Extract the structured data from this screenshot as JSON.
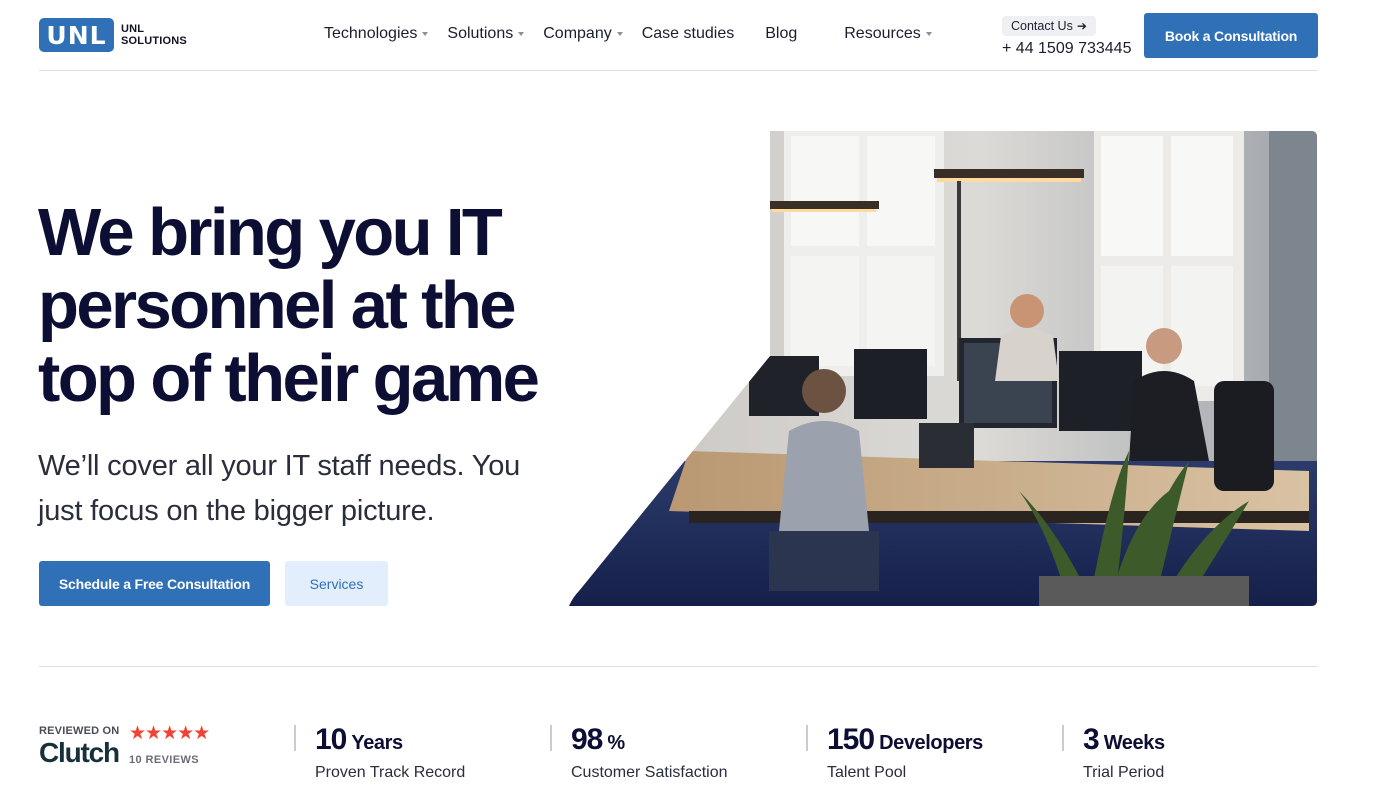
{
  "header": {
    "logo_mark": "UNL",
    "logo_line1": "UNL",
    "logo_line2": "SOLUTIONS",
    "nav": [
      {
        "label": "Technologies",
        "has_dropdown": true
      },
      {
        "label": "Solutions",
        "has_dropdown": true
      },
      {
        "label": "Company",
        "has_dropdown": true
      },
      {
        "label": "Case studies",
        "has_dropdown": false
      },
      {
        "label": "Blog",
        "has_dropdown": false
      },
      {
        "label": "Resources",
        "has_dropdown": true
      }
    ],
    "contact_label": "Contact Us",
    "contact_icon": "arrow-right-icon",
    "phone": "+ 44 1509 733445",
    "cta": "Book a Consultation"
  },
  "hero": {
    "title_lines": [
      "We bring you IT",
      "personnel at the",
      "top of their game"
    ],
    "subtitle_lines": [
      "We’ll cover all your IT staff needs. You",
      "just focus on the bigger picture."
    ],
    "primary_button": "Schedule a Free Consultation",
    "secondary_button": "Services",
    "image": "office-photo-developers-at-desks"
  },
  "stats": {
    "clutch": {
      "reviewed_on": "REVIEWED ON",
      "brand": "Clutch",
      "stars": "★★★★★",
      "rating": 5,
      "reviews": "10 REVIEWS"
    },
    "items": [
      {
        "number": "10",
        "unit": "Years",
        "label": "Proven Track Record"
      },
      {
        "number": "98",
        "unit": "%",
        "label": "Customer Satisfaction"
      },
      {
        "number": "150",
        "unit": "Developers",
        "label": "Talent Pool"
      },
      {
        "number": "3",
        "unit": "Weeks",
        "label": "Trial Period"
      }
    ]
  },
  "colors": {
    "brand_blue": "#2f70b7",
    "heading": "#0c0f33",
    "secondary_button_bg": "#e3eefc",
    "clutch_red": "#ef4335"
  }
}
